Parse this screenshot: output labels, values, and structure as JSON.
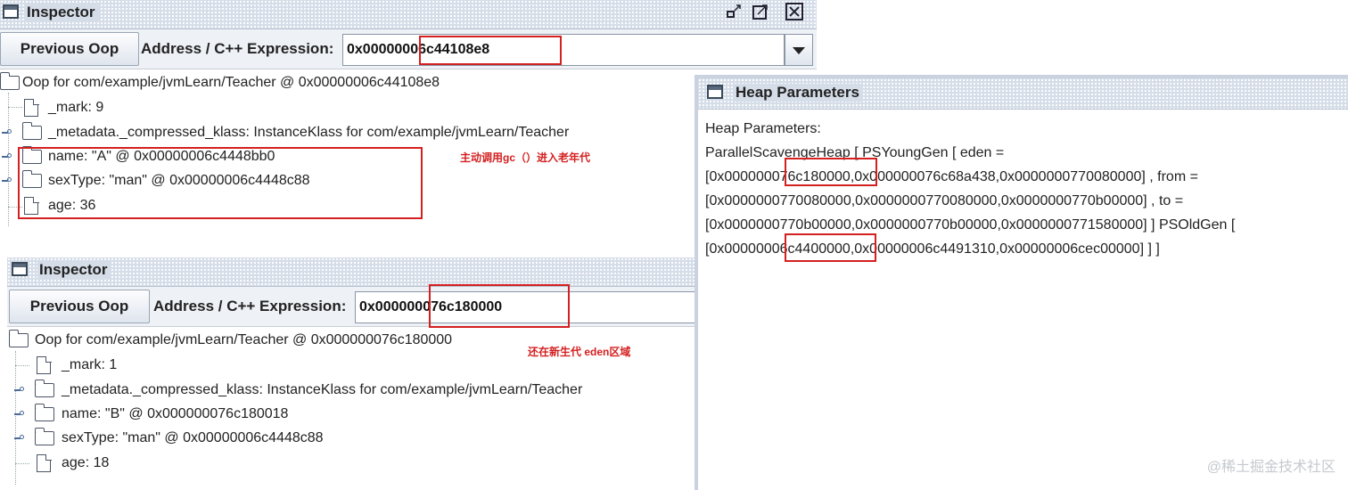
{
  "inspector1": {
    "title": "Inspector",
    "previous_label": "Previous Oop",
    "address_label": "Address / C++ Expression:",
    "address_value": "0x00000006c44108e8",
    "tree": [
      {
        "text": "Oop for com/example/jvmLearn/Teacher @ 0x00000006c44108e8",
        "icon": "folder-icon"
      },
      {
        "text": "_mark: 9",
        "icon": "file-icon"
      },
      {
        "text": "_metadata._compressed_klass: InstanceKlass for com/example/jvmLearn/Teacher",
        "icon": "folder-icon"
      },
      {
        "text": "name: \"A\" @ 0x00000006c4448bb0",
        "icon": "folder-icon"
      },
      {
        "text": "sexType: \"man\" @ 0x00000006c4448c88",
        "icon": "folder-icon"
      },
      {
        "text": "age: 36",
        "icon": "file-icon"
      }
    ],
    "annotation": "主动调用gc（）进入老年代"
  },
  "inspector2": {
    "title": "Inspector",
    "previous_label": "Previous Oop",
    "address_label": "Address / C++ Expression:",
    "address_value": "0x000000076c180000",
    "tree": [
      {
        "text": "Oop for com/example/jvmLearn/Teacher @ 0x000000076c180000",
        "icon": "folder-icon"
      },
      {
        "text": "_mark: 1",
        "icon": "file-icon"
      },
      {
        "text": "_metadata._compressed_klass: InstanceKlass for com/example/jvmLearn/Teacher",
        "icon": "folder-icon"
      },
      {
        "text": "name: \"B\" @ 0x000000076c180018",
        "icon": "folder-icon"
      },
      {
        "text": "sexType: \"man\" @ 0x00000006c4448c88",
        "icon": "folder-icon"
      },
      {
        "text": "age: 18",
        "icon": "file-icon"
      }
    ],
    "annotation": "还在新生代 eden区域"
  },
  "heap": {
    "title": "Heap Parameters",
    "lines": [
      "Heap Parameters:",
      "ParallelScavengeHeap [ PSYoungGen [ eden =",
      "[0x000000076c180000,0x000000076c68a438,0x0000000770080000] , from =",
      "[0x0000000770080000,0x0000000770080000,0x0000000770b00000] , to =",
      "[0x0000000770b00000,0x0000000770b00000,0x0000000771580000]  ] PSOldGen [",
      "[0x00000006c4400000,0x00000006c4491310,0x00000006cec00000]  ]  ]"
    ]
  },
  "watermark": "@稀土掘金技术社区",
  "colors": {
    "highlight": "#d42020",
    "titlebar": "#d5dde8"
  }
}
